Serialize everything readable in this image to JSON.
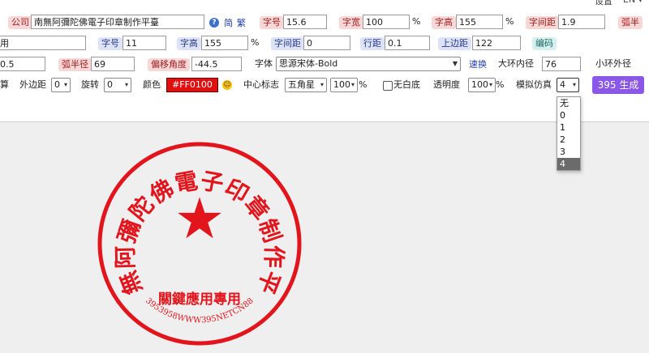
{
  "top_right": {
    "lang": "设置",
    "extra": "EN"
  },
  "row1": {
    "company_label": "公司",
    "company_value": "南無阿彌陀佛電子印章制作平臺",
    "simp": "简",
    "trad": "繁",
    "font_size_label": "字号",
    "font_size": "15.6",
    "char_width_label": "字宽",
    "char_width": "100",
    "char_width_unit": "%",
    "char_height_label": "字高",
    "char_height": "155",
    "char_height_unit": "%",
    "char_spacing_label": "字间距",
    "char_spacing": "1.9",
    "arc_half_label": "弧半"
  },
  "row2": {
    "usage_value": "用",
    "font_size_label": "字号",
    "font_size": "11",
    "char_height_label": "字高",
    "char_height": "155",
    "char_height_unit": "%",
    "char_spacing_label": "字间距",
    "char_spacing": "0",
    "line_spacing_label": "行距",
    "line_spacing": "0.1",
    "top_margin_label": "上边距",
    "top_margin": "122",
    "code_label": "编码"
  },
  "row3": {
    "left_value": "0.5",
    "arc_radius_label": "弧半径",
    "arc_radius": "69",
    "offset_angle_label": "偏移角度",
    "offset_angle": "-44.5",
    "font_label": "字体",
    "font_value": "思源宋体-Bold",
    "quick_switch": "速换",
    "outer_ring_label": "大环内径",
    "outer_ring": "76",
    "small_ring_label": "小环外径"
  },
  "row4": {
    "calc_label": "算",
    "outer_margin_label": "外边距",
    "outer_margin": "0",
    "rotation_label": "旋转",
    "rotation": "0",
    "color_label": "颜色",
    "color_value": "#FF0100",
    "center_mark_label": "中心标志",
    "center_mark": "五角星",
    "center_scale": "100",
    "center_scale_unit": "%",
    "no_bg_label": "无白底",
    "opacity_label": "透明度",
    "opacity": "100",
    "opacity_unit": "%",
    "sim_label": "模拟仿真",
    "sim_value": "4",
    "generate": "395 生成"
  },
  "sim_options": [
    "无",
    "0",
    "1",
    "2",
    "3",
    "4"
  ],
  "stamp": {
    "top_text": "南無阿彌陀佛電子印章制作平臺",
    "middle_text": "關鍵應用專用",
    "bottom_text": "3953958WWW395NETCN88",
    "center_mark": "★"
  },
  "colors": {
    "stamp_red": "#e2141c",
    "accent": "#8a57e8"
  }
}
